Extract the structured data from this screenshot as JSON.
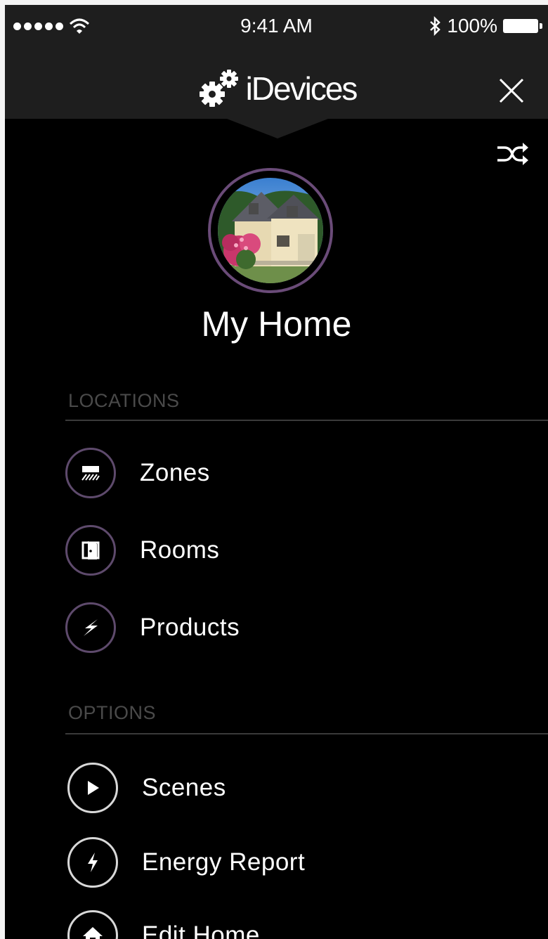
{
  "status_bar": {
    "time": "9:41 AM",
    "battery": "100%"
  },
  "header": {
    "brand": "iDevices"
  },
  "profile": {
    "home_name": "My Home"
  },
  "locations": {
    "label": "LOCATIONS",
    "items": [
      {
        "label": "Zones",
        "icon": "zones-icon"
      },
      {
        "label": "Rooms",
        "icon": "rooms-door-icon"
      },
      {
        "label": "Products",
        "icon": "products-plug-icon"
      }
    ]
  },
  "options": {
    "label": "OPTIONS",
    "items": [
      {
        "label": "Scenes",
        "icon": "play-icon"
      },
      {
        "label": "Energy Report",
        "icon": "lightning-icon"
      },
      {
        "label": "Edit Home",
        "icon": "home-icon"
      }
    ]
  },
  "colors": {
    "background": "#000000",
    "header": "#1e1e1e",
    "accent_ring": "#6a4b78",
    "section_label": "#4a4a4a"
  }
}
